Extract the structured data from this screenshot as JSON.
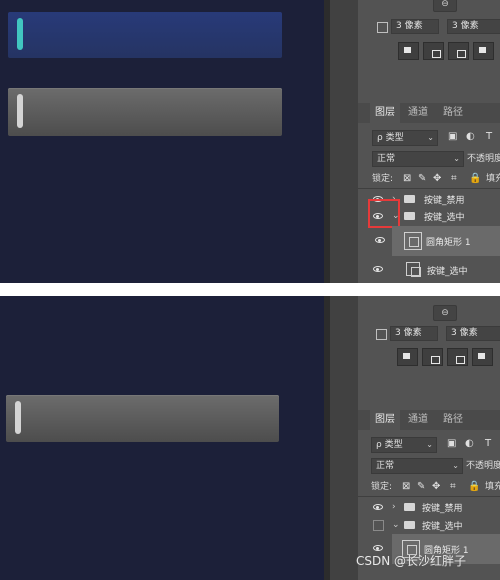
{
  "panels": [
    {
      "link_icon": "link-icon",
      "radius_left": "3 像素",
      "radius_right": "3 像素",
      "tabs": [
        "图层",
        "通道",
        "路径"
      ],
      "filter_kind": "ρ 类型",
      "blend_mode": "正常",
      "opacity_label": "不透明度",
      "lock_label": "锁定:",
      "fill_label": "填充",
      "layers": [
        {
          "name": "按键_禁用",
          "visible": true
        },
        {
          "name": "按键_选中",
          "visible": true
        },
        {
          "name": "圆角矩形 1",
          "visible": true
        },
        {
          "name": "按键_选中",
          "visible": true
        }
      ]
    },
    {
      "link_icon": "link-icon",
      "radius_left": "3 像素",
      "radius_right": "3 像素",
      "tabs": [
        "图层",
        "通道",
        "路径"
      ],
      "filter_kind": "ρ 类型",
      "blend_mode": "正常",
      "opacity_label": "不透明度",
      "lock_label": "锁定:",
      "fill_label": "填充",
      "layers": [
        {
          "name": "按键_禁用",
          "visible": true
        },
        {
          "name": "按键_选中",
          "visible": false
        },
        {
          "name": "圆角矩形 1",
          "visible": true
        }
      ]
    }
  ],
  "watermark": "CSDN @长沙红胖子",
  "colors": {
    "canvas": "#1c2039",
    "teal_indicator": "#41c6c0",
    "highlight": "#e63a3a"
  }
}
